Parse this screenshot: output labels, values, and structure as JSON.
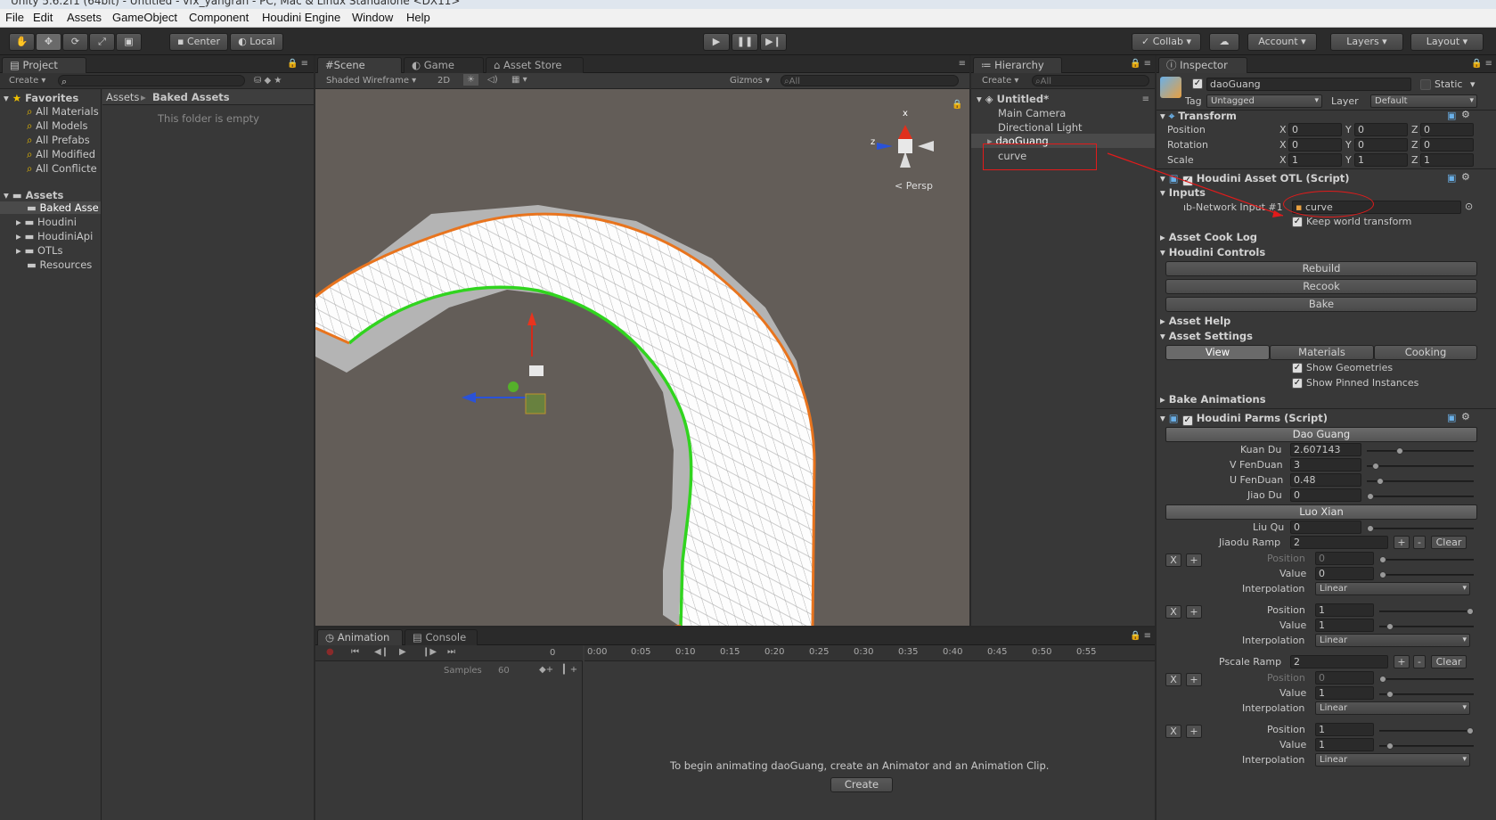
{
  "window_title": "Unity 5.6.2f1 (64bit) - Untitled - vfx_yangran - PC, Mac & Linux Standalone <DX11>",
  "menu": [
    "File",
    "Edit",
    "Assets",
    "GameObject",
    "Component",
    "Houdini Engine",
    "Window",
    "Help"
  ],
  "toolbar": {
    "center": "Center",
    "local": "Local",
    "collab": "Collab",
    "account": "Account",
    "layers": "Layers",
    "layout": "Layout"
  },
  "project": {
    "tab": "Project",
    "create": "Create",
    "favorites_label": "Favorites",
    "favorites": [
      "All Materials",
      "All Models",
      "All Prefabs",
      "All Modified",
      "All Conflicte"
    ],
    "assets_label": "Assets",
    "assets": [
      "Baked Asse",
      "Houdini",
      "HoudiniApi",
      "OTLs",
      "Resources"
    ],
    "breadcrumb_root": "Assets",
    "breadcrumb_current": "Baked Assets",
    "empty": "This folder is empty"
  },
  "scene": {
    "tabs": [
      "Scene",
      "Game",
      "Asset Store"
    ],
    "shading": "Shaded Wireframe",
    "mode2d": "2D",
    "gizmos": "Gizmos",
    "search": "All",
    "persp": "Persp",
    "axis_x": "x",
    "axis_z": "z"
  },
  "hierarchy": {
    "tab": "Hierarchy",
    "create": "Create",
    "search": "All",
    "scene_name": "Untitled*",
    "items": [
      "Main Camera",
      "Directional Light",
      "daoGuang",
      "curve"
    ]
  },
  "animation": {
    "tabs": [
      "Animation",
      "Console"
    ],
    "samples_label": "Samples",
    "samples": "60",
    "zero": "0",
    "ticks": [
      "0:00",
      "0:05",
      "0:10",
      "0:15",
      "0:20",
      "0:25",
      "0:30",
      "0:35",
      "0:40",
      "0:45",
      "0:50",
      "0:55"
    ],
    "message": "To begin animating daoGuang, create an Animator and an Animation Clip.",
    "create": "Create"
  },
  "inspector": {
    "tab": "Inspector",
    "object_name": "daoGuang",
    "static": "Static",
    "tag_label": "Tag",
    "tag": "Untagged",
    "layer_label": "Layer",
    "layer": "Default",
    "transform": {
      "title": "Transform",
      "rows": [
        {
          "label": "Position",
          "x": "0",
          "y": "0",
          "z": "0"
        },
        {
          "label": "Rotation",
          "x": "0",
          "y": "0",
          "z": "0"
        },
        {
          "label": "Scale",
          "x": "1",
          "y": "1",
          "z": "1"
        }
      ],
      "axes": [
        "X",
        "Y",
        "Z"
      ]
    },
    "otl": {
      "title": "Houdini Asset OTL (Script)",
      "inputs": "Inputs",
      "input_label": "ıb-Network Input #1",
      "input_value": "curve",
      "keep_world": "Keep world transform",
      "cook_log": "Asset Cook Log",
      "controls": "Houdini Controls",
      "rebuild": "Rebuild",
      "recook": "Recook",
      "bake": "Bake",
      "help": "Asset Help",
      "settings": "Asset Settings",
      "settings_tabs": [
        "View",
        "Materials",
        "Cooking"
      ],
      "show_geo": "Show Geometries",
      "show_pinned": "Show Pinned Instances",
      "bake_anim": "Bake Animations"
    },
    "parms": {
      "title": "Houdini Parms (Script)",
      "folder1": "Dao Guang",
      "fields1": [
        {
          "label": "Kuan Du",
          "value": "2.607143",
          "level": 0.3
        },
        {
          "label": "V FenDuan",
          "value": "3",
          "level": 0.05
        },
        {
          "label": "U FenDuan",
          "value": "0.48",
          "level": 0.1
        },
        {
          "label": "Jiao Du",
          "value": "0",
          "level": 0.0
        }
      ],
      "folder2": "Luo Xian",
      "liuqu_label": "Liu Qu",
      "liuqu": "0",
      "jiaodu_ramp_label": "Jiaodu Ramp",
      "jiaodu_ramp": "2",
      "clear": "Clear",
      "plus": "+",
      "minus": "-",
      "x": "X",
      "ramp1": [
        {
          "position": "0",
          "value": "0",
          "interp": "Linear"
        },
        {
          "position": "1",
          "value": "1",
          "interp": "Linear"
        }
      ],
      "pscale_ramp_label": "Pscale Ramp",
      "pscale_ramp": "2",
      "ramp2": [
        {
          "position": "0",
          "value": "1",
          "interp": "Linear"
        },
        {
          "position": "1",
          "value": "1",
          "interp": "Linear"
        }
      ],
      "position_label": "Position",
      "value_label": "Value",
      "interp_label": "Interpolation"
    }
  },
  "colors": {
    "accent_selected": "#3e5f96",
    "annotation_red": "#e21b1b",
    "mesh_orange": "#e8741e",
    "mesh_green": "#31d41f"
  }
}
